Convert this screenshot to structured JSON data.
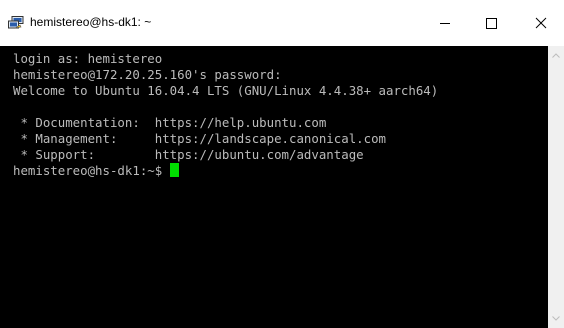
{
  "window": {
    "title": "hemistereo@hs-dk1: ~",
    "app_icon": "putty-icon",
    "controls": {
      "minimize_icon": "minimize-icon",
      "maximize_icon": "maximize-icon",
      "close_icon": "close-icon"
    }
  },
  "terminal": {
    "lines": [
      "login as: hemistereo",
      "hemistereo@172.20.25.160's password:",
      "Welcome to Ubuntu 16.04.4 LTS (GNU/Linux 4.4.38+ aarch64)",
      "",
      " * Documentation:  https://help.ubuntu.com",
      " * Management:     https://landscape.canonical.com",
      " * Support:        https://ubuntu.com/advantage"
    ],
    "prompt": "hemistereo@hs-dk1:~$ ",
    "colors": {
      "background": "#000000",
      "foreground": "#bbbbbb",
      "cursor": "#00e000"
    }
  },
  "scrollbar": {
    "up_icon": "scroll-up-arrow-icon",
    "down_icon": "scroll-down-arrow-icon"
  }
}
